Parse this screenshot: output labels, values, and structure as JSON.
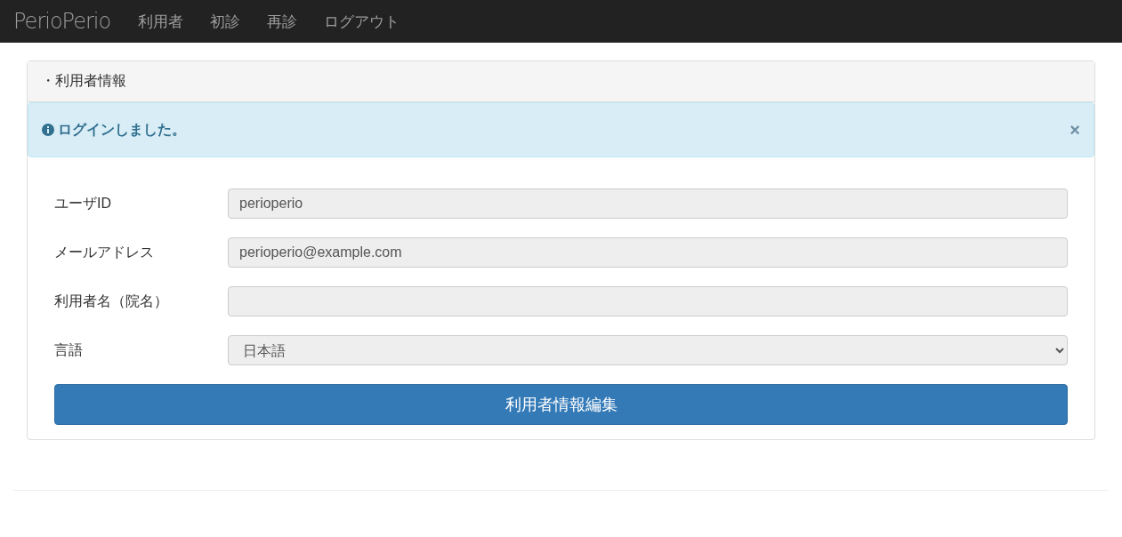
{
  "navbar": {
    "brand": "PerioPerio",
    "links": [
      "利用者",
      "初診",
      "再診",
      "ログアウト"
    ]
  },
  "panel": {
    "heading": "・利用者情報",
    "alert": {
      "message": "ログインしました。",
      "close": "×"
    },
    "fields": [
      {
        "kind": "input",
        "label": "ユーザID",
        "value": "perioperio",
        "disabled": true
      },
      {
        "kind": "input",
        "label": "メールアドレス",
        "value": "perioperio@example.com",
        "disabled": true
      },
      {
        "kind": "input",
        "label": "利用者名（院名）",
        "disabled": true
      },
      {
        "kind": "select",
        "label": "言語",
        "value": "日本語",
        "disabled": true
      }
    ],
    "submit": "利用者情報編集"
  }
}
